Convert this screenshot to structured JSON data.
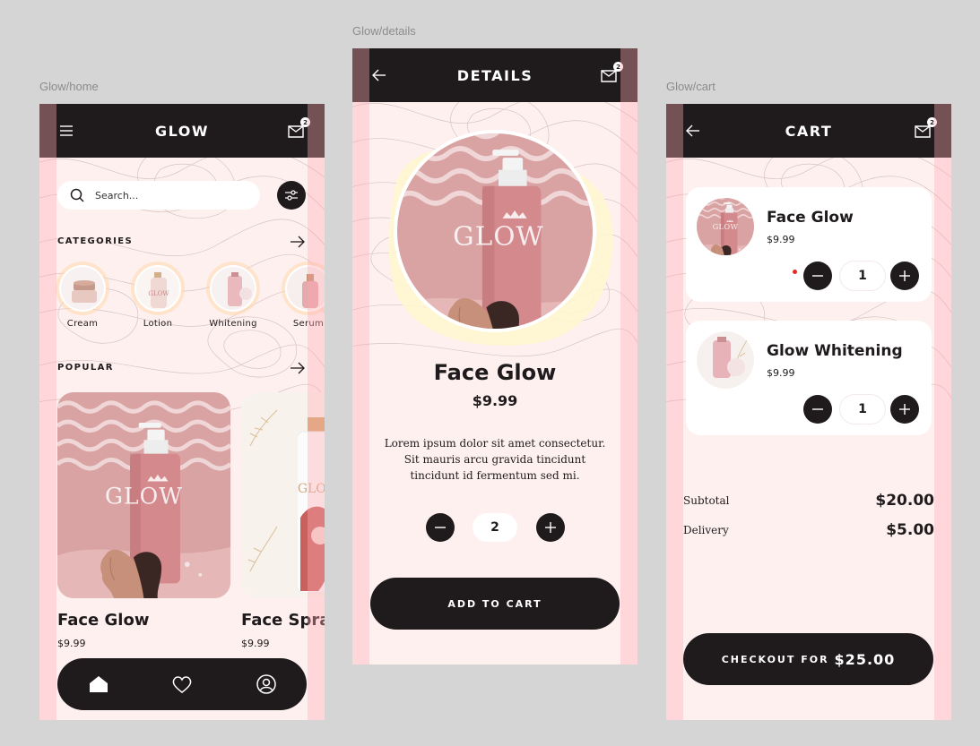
{
  "labels": {
    "home": "Glow/home",
    "details": "Glow/details",
    "cart": "Glow/cart"
  },
  "colors": {
    "dark": "#1f1b1c",
    "background": "#fff0f0",
    "pink_product": "#d48c8e",
    "accent_red": "#e02a2a"
  },
  "home": {
    "brand": "GLOW",
    "cart_badge": "2",
    "search": {
      "placeholder": "Search..."
    },
    "categories_title": "CATEGORIES",
    "categories": [
      {
        "label": "Cream",
        "icon": "cream-jar"
      },
      {
        "label": "Lotion",
        "icon": "lotion-bottle"
      },
      {
        "label": "Whitening",
        "icon": "whitening-tube"
      },
      {
        "label": "Serum",
        "icon": "serum-bottle"
      }
    ],
    "popular_title": "POPULAR",
    "products": [
      {
        "name": "Face Glow",
        "price": "$9.99",
        "bottle_text": "GLOW"
      },
      {
        "name": "Face Spray",
        "price": "$9.99",
        "bottle_text": "GLOW"
      }
    ],
    "nav": [
      "home-icon",
      "heart-icon",
      "profile-icon"
    ]
  },
  "details": {
    "title": "DETAILS",
    "cart_badge": "2",
    "bottle_text": "GLOW",
    "product_name": "Face Glow",
    "price": "$9.99",
    "description": "Lorem ipsum dolor sit amet consectetur. Sit mauris arcu gravida tincidunt tincidunt id fermentum sed mi.",
    "quantity": "2",
    "add_to_cart": "ADD TO CART"
  },
  "cart": {
    "title": "CART",
    "cart_badge": "2",
    "items": [
      {
        "name": "Face Glow",
        "price": "$9.99",
        "quantity": "1"
      },
      {
        "name": "Glow Whitening",
        "price": "$9.99",
        "quantity": "1"
      }
    ],
    "subtotal_label": "Subtotal",
    "subtotal_value": "$20.00",
    "delivery_label": "Delivery",
    "delivery_value": "$5.00",
    "checkout_label": "CHECKOUT FOR",
    "checkout_amount": "$25.00"
  }
}
